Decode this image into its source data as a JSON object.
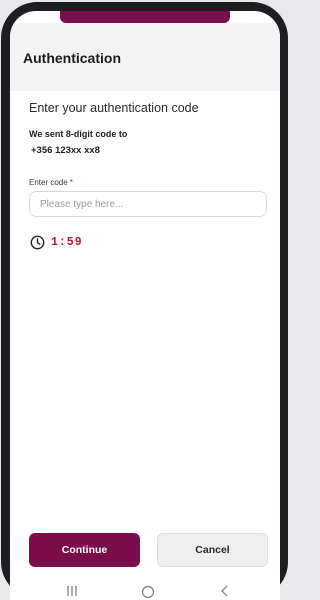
{
  "header": {
    "title": "Authentication"
  },
  "content": {
    "heading": "Enter your authentication code",
    "sent_message": "We sent 8-digit code to",
    "phone_number": "+356 123xx xx8",
    "code_field": {
      "label": "Enter code",
      "required_mark": "*",
      "placeholder": "Please type here...",
      "value": ""
    },
    "timer": {
      "icon": "clock-icon",
      "remaining": "1:59"
    }
  },
  "actions": {
    "continue_label": "Continue",
    "cancel_label": "Cancel"
  },
  "system_nav": {
    "icons": [
      "recent-apps-icon",
      "home-icon",
      "back-icon"
    ]
  },
  "colors": {
    "brand": "#7b0d4a",
    "timer": "#b3182d",
    "required": "#c0182f"
  }
}
